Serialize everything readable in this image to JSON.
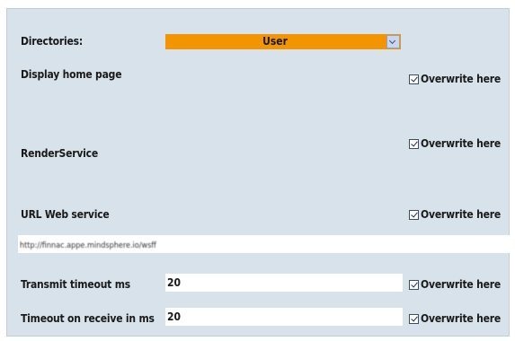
{
  "directories": {
    "label": "Directories:",
    "value": "User"
  },
  "overwrite_label": "Overwrite here",
  "display_home_page": {
    "label": "Display home page",
    "overwrite_checked": true
  },
  "render_service": {
    "label": "RenderService",
    "overwrite_checked": true
  },
  "url_web_service": {
    "label": "URL Web service",
    "overwrite_checked": true,
    "value": "http://finnac.appe.mindsphere.io/wsff"
  },
  "transmit_timeout": {
    "label": "Transmit timeout ms",
    "value": "20",
    "overwrite_checked": true
  },
  "receive_timeout": {
    "label": "Timeout on receive in ms",
    "value": "20",
    "overwrite_checked": true
  },
  "colors": {
    "panel_bg": "#d8e2eb",
    "dropdown_accent": "#f39500",
    "field_bg": "#ffffff"
  }
}
